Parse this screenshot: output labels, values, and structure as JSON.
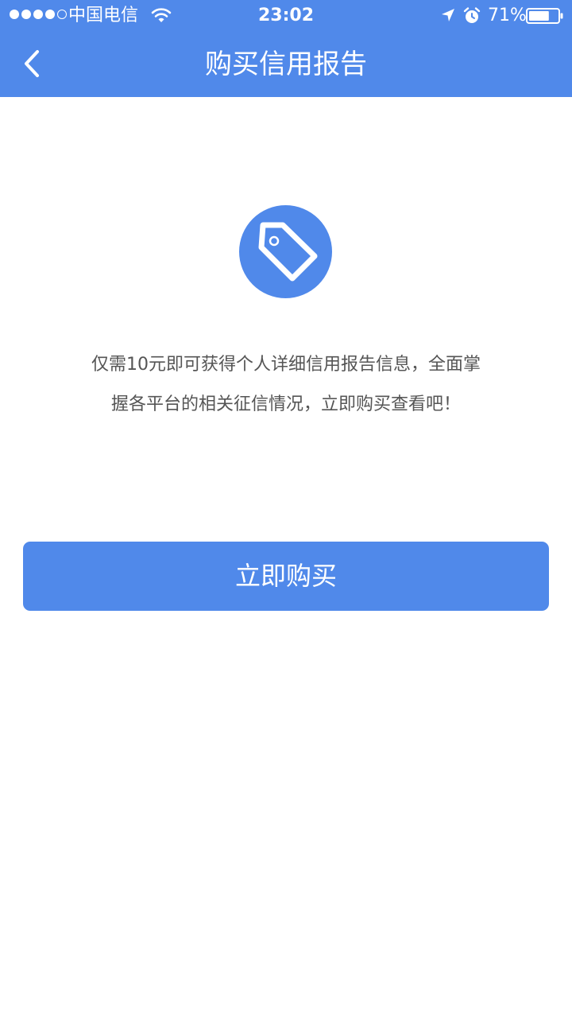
{
  "status_bar": {
    "carrier": "中国电信",
    "time": "23:02",
    "battery_percent": "71%",
    "battery_level": 0.71,
    "signal_bars_filled": 4,
    "signal_bars_total": 5
  },
  "nav": {
    "title": "购买信用报告",
    "back_icon": "chevron-left-icon"
  },
  "content": {
    "icon": "price-tag-icon",
    "description_line1": "仅需10元即可获得个人详细信用报告信息，全面掌",
    "description_line2": "握各平台的相关征信情况，立即购买查看吧！"
  },
  "actions": {
    "buy_label": "立即购买"
  },
  "colors": {
    "accent": "#5089ea",
    "background": "#ffffff",
    "text_secondary": "#555555"
  }
}
